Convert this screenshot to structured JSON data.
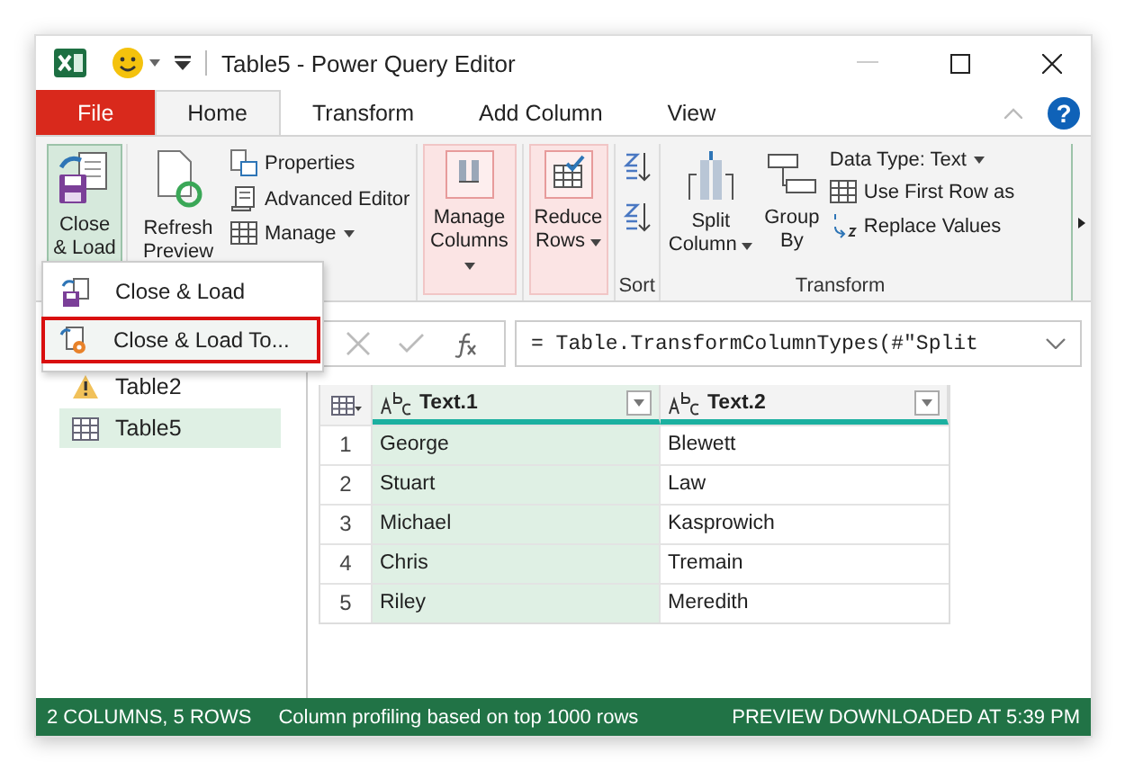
{
  "window": {
    "title": "Table5 - Power Query Editor"
  },
  "tabs": [
    {
      "label": "File",
      "kind": "file",
      "selected": false
    },
    {
      "label": "Home",
      "kind": "tab",
      "selected": true
    },
    {
      "label": "Transform",
      "kind": "tab",
      "selected": false
    },
    {
      "label": "Add Column",
      "kind": "tab",
      "selected": false
    },
    {
      "label": "View",
      "kind": "tab",
      "selected": false
    }
  ],
  "help": "?",
  "ribbon": {
    "close_load": {
      "label": "Close & Load",
      "expanded": true
    },
    "refresh": {
      "label": "Refresh Preview"
    },
    "query_items": [
      {
        "label": "Properties",
        "kind": "properties",
        "dropdown": false
      },
      {
        "label": "Advanced Editor",
        "kind": "editor",
        "dropdown": false
      },
      {
        "label": "Manage",
        "kind": "manage",
        "dropdown": true
      }
    ],
    "manage_columns": {
      "label": "Manage Columns"
    },
    "reduce_rows": {
      "label": "Reduce Rows"
    },
    "sort": {
      "label": "Sort"
    },
    "split": {
      "label": "Split Column"
    },
    "group": {
      "label": "Group By"
    },
    "transform_items": [
      {
        "label": "Data Type: Text",
        "kind": "type",
        "dropdown": true
      },
      {
        "label": "Use First Row as",
        "kind": "grid",
        "dropdown": false
      },
      {
        "label": "Replace Values",
        "kind": "replace",
        "dropdown": false
      }
    ],
    "transform": {
      "label": "Transform"
    }
  },
  "menu": [
    {
      "label": "Close & Load",
      "kind": "load",
      "selected": false
    },
    {
      "label": "Close & Load To...",
      "kind": "load_to",
      "selected": true
    }
  ],
  "queries": [
    {
      "name": "Table2",
      "kind": "warning",
      "selected": false
    },
    {
      "name": "Table5",
      "kind": "table",
      "selected": true
    }
  ],
  "formula": "= Table.TransformColumnTypes(#\"Split",
  "table": {
    "columns": [
      {
        "name": "Text.1",
        "selected": true
      },
      {
        "name": "Text.2",
        "selected": false
      }
    ],
    "rows": [
      {
        "number": "1",
        "cells": [
          "George",
          "Blewett"
        ]
      },
      {
        "number": "2",
        "cells": [
          "Stuart",
          "Law"
        ]
      },
      {
        "number": "3",
        "cells": [
          "Michael",
          "Kasprowich"
        ]
      },
      {
        "number": "4",
        "cells": [
          "Chris",
          "Tremain"
        ]
      },
      {
        "number": "5",
        "cells": [
          "Riley",
          "Meredith"
        ]
      }
    ]
  },
  "status_bar": {
    "left": "2 COLUMNS, 5 ROWS",
    "middle": "Column profiling based on top 1000 rows",
    "right": "PREVIEW DOWNLOADED AT 5:39 PM"
  }
}
